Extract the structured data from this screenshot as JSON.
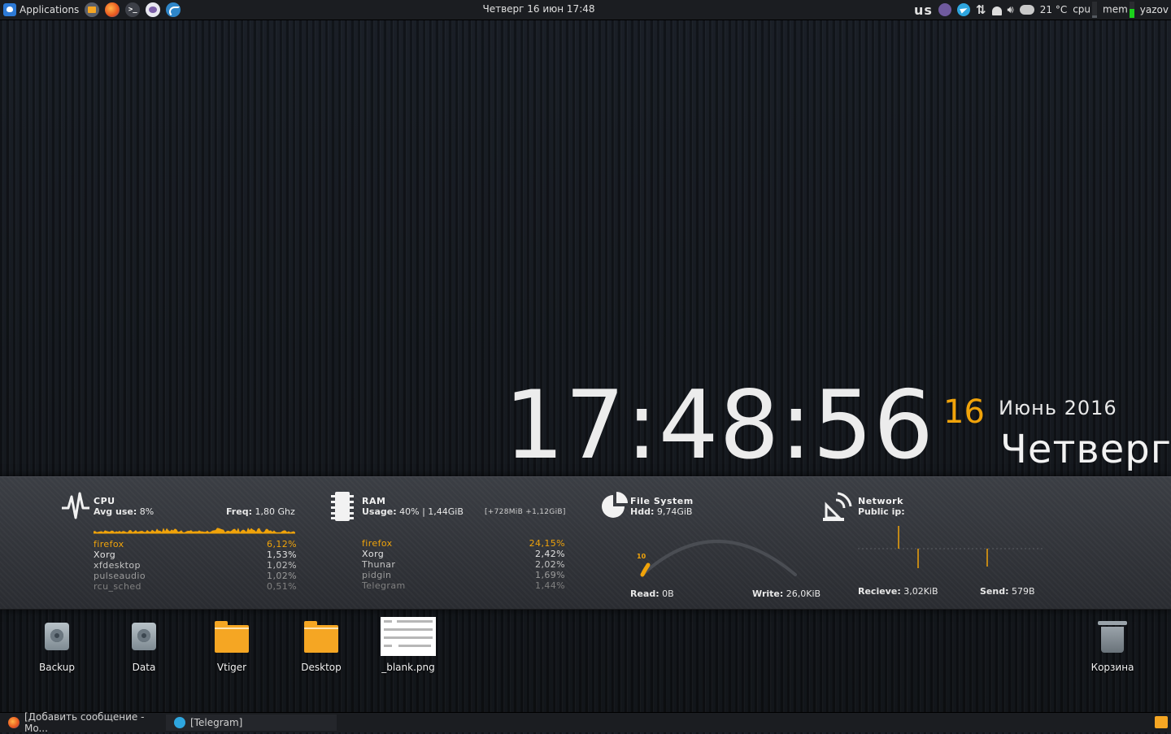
{
  "top_panel": {
    "applications_label": "Applications",
    "clock": "Четверг 16 июн 17:48",
    "keyboard_layout": "us",
    "weather_temp": "21 °C",
    "cpu_label": "cpu",
    "mem_label": "mem",
    "username": "yazov",
    "cpu_level": 0.15,
    "mem_level": 0.55
  },
  "clock": {
    "time": "17:48:56",
    "day": "16",
    "month_year": "Июнь 2016",
    "weekday": "Четверг"
  },
  "cpu": {
    "title": "CPU",
    "avg_label": "Avg use:",
    "avg_value": "8%",
    "freq_label": "Freq:",
    "freq_value": "1,80 Ghz",
    "processes": [
      {
        "name": "firefox",
        "value": "6,12%"
      },
      {
        "name": "Xorg",
        "value": "1,53%"
      },
      {
        "name": "xfdesktop",
        "value": "1,02%"
      },
      {
        "name": "pulseaudio",
        "value": "1,02%"
      },
      {
        "name": "rcu_sched",
        "value": "0,51%"
      }
    ]
  },
  "ram": {
    "title": "RAM",
    "usage_label": "Usage:",
    "usage_value": "40% | 1,44GiB",
    "extra": "[+728MiB +1,12GiB]",
    "processes": [
      {
        "name": "firefox",
        "value": "24,15%"
      },
      {
        "name": "Xorg",
        "value": "2,42%"
      },
      {
        "name": "Thunar",
        "value": "2,02%"
      },
      {
        "name": "pidgin",
        "value": "1,69%"
      },
      {
        "name": "Telegram",
        "value": "1,44%"
      }
    ]
  },
  "filesystem": {
    "title": "File System",
    "hdd_label": "Hdd:",
    "hdd_value": "9,74GiB",
    "gauge_value": "10",
    "read_label": "Read:",
    "read_value": "0B",
    "write_label": "Write:",
    "write_value": "26,0KiB"
  },
  "network": {
    "title": "Network",
    "ip_label": "Public ip:",
    "recv_label": "Recieve:",
    "recv_value": "3,02KiB",
    "send_label": "Send:",
    "send_value": "579B"
  },
  "desktop_icons": [
    "Backup",
    "Data",
    "Vtiger",
    "Desktop",
    "_blank.png",
    "Корзина"
  ],
  "taskbar": {
    "task1": "[Добавить сообщение - Mo...",
    "task2": "[Telegram]"
  },
  "colors": {
    "accent": "#f0a30a",
    "mem_meter": "#1bd11b",
    "folder": "#f5a623"
  }
}
